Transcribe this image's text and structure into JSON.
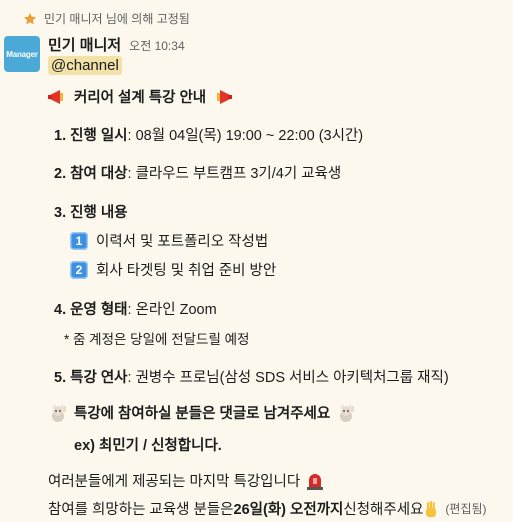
{
  "pinned": {
    "text": "민기 매니저 님에 의해 고정됨"
  },
  "message": {
    "avatar_text": "Manager",
    "sender": "민기 매니저",
    "time": "오전 10:34",
    "mention": "@channel",
    "title": "커리어 설계 특강 안내",
    "items": [
      {
        "label": "1. 진행 일시",
        "value": " : 08월 04일(목) 19:00 ~ 22:00 (3시간)"
      },
      {
        "label": "2. 참여 대상",
        "value": " : 클라우드 부트캠프 3기/4기 교육생"
      },
      {
        "label": "3. 진행 내용",
        "value": ""
      },
      {
        "label": "4. 운영 형태",
        "value": " : 온라인 Zoom"
      },
      {
        "label": "5. 특강 연사",
        "value": " : 권병수 프로님(삼성 SDS 서비스 아키텍처그룹 재직)"
      }
    ],
    "content_items": [
      {
        "key": "1",
        "text": "이력서 및 포트폴리오 작성법"
      },
      {
        "key": "2",
        "text": "회사 타겟팅 및 취업 준비 방안"
      }
    ],
    "zoom_note": "* 줌 계정은 당일에 전달드릴 예정",
    "comment_request": "특강에 참여하실 분들은 댓글로 남겨주세요",
    "example": "ex) 최민기 / 신청합니다.",
    "final_notice": "여러분들에게 제공되는 마지막 특강입니다",
    "deadline_pre": "참여를 희망하는 교육생 분들은 ",
    "deadline_bold": "26일(화) 오전까지",
    "deadline_post": " 신청해주세요",
    "edited": "(편집됨)"
  },
  "icons": {
    "pin": "pushpin-icon",
    "megaphone": "megaphone-icon",
    "cat": "waving-cat-icon",
    "siren": "siren-icon",
    "hand": "raised-hand-icon"
  },
  "colors": {
    "background": "#fcf8ed",
    "mention_bg": "#f2e2a8",
    "keycap": "#3d8fe0",
    "avatar": "#4aa9d6"
  }
}
